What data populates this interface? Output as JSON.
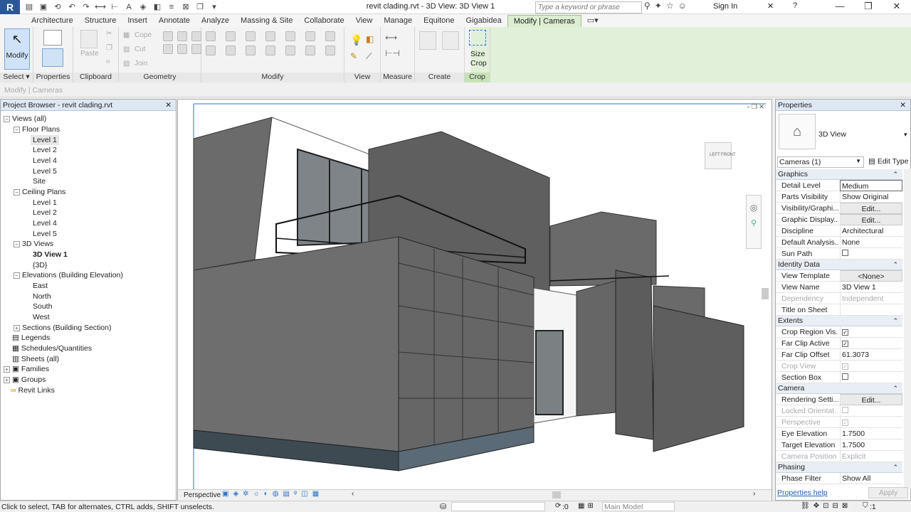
{
  "window": {
    "title": "revit clading.rvt - 3D View: 3D View 1",
    "search_placeholder": "Type a keyword or phrase",
    "sign_in": "Sign In",
    "app_letter": "R"
  },
  "tabs": [
    "Architecture",
    "Structure",
    "Insert",
    "Annotate",
    "Analyze",
    "Massing & Site",
    "Collaborate",
    "View",
    "Manage",
    "Equitone",
    "Gigabidea",
    "Modify | Cameras"
  ],
  "ribbon": {
    "modify": "Modify",
    "select": "Select ▾",
    "properties": "Properties",
    "clipboard": "Clipboard",
    "paste": "Paste",
    "cope": "Cope",
    "cut": "Cut",
    "join": "Join",
    "geometry": "Geometry",
    "modify_panel": "Modify",
    "view": "View",
    "measure": "Measure",
    "create": "Create",
    "size_crop_1": "Size",
    "size_crop_2": "Crop",
    "crop": "Crop"
  },
  "option_bar": "Modify | Cameras",
  "project_browser": {
    "title": "Project Browser - revit clading.rvt",
    "items": [
      "Views (all)",
      "Floor Plans",
      "Level 1",
      "Level 2",
      "Level 4",
      "Level 5",
      "Site",
      "Ceiling Plans",
      "Level 1",
      "Level 2",
      "Level 4",
      "Level 5",
      "3D Views",
      "3D View 1",
      "{3D}",
      "Elevations (Building Elevation)",
      "East",
      "North",
      "South",
      "West",
      "Sections (Building Section)",
      "Legends",
      "Schedules/Quantities",
      "Sheets (all)",
      "Families",
      "Groups",
      "Revit Links"
    ]
  },
  "viewport": {
    "view_mode": "Perspective",
    "cube_left": "LEFT",
    "cube_front": "FRONT"
  },
  "properties": {
    "title": "Properties",
    "type": "3D View",
    "selector": "Cameras (1)",
    "edit_type": "Edit Type",
    "sections": {
      "graphics": "Graphics",
      "identity": "Identity Data",
      "extents": "Extents",
      "camera": "Camera",
      "phasing": "Phasing"
    },
    "rows": {
      "detail_level": [
        "Detail Level",
        "Medium"
      ],
      "parts_visibility": [
        "Parts Visibility",
        "Show Original"
      ],
      "vis_graphics": [
        "Visibility/Graphi...",
        "Edit..."
      ],
      "graphic_display": [
        "Graphic Display...",
        "Edit..."
      ],
      "discipline": [
        "Discipline",
        "Architectural"
      ],
      "default_analysis": [
        "Default Analysis...",
        "None"
      ],
      "sun_path": [
        "Sun Path",
        ""
      ],
      "view_template": [
        "View Template",
        "<None>"
      ],
      "view_name": [
        "View Name",
        "3D View 1"
      ],
      "dependency": [
        "Dependency",
        "Independent"
      ],
      "title_on_sheet": [
        "Title on Sheet",
        ""
      ],
      "crop_region": [
        "Crop Region Vis...",
        ""
      ],
      "far_clip_active": [
        "Far Clip Active",
        ""
      ],
      "far_clip_offset": [
        "Far Clip Offset",
        "61.3073"
      ],
      "crop_view": [
        "Crop View",
        ""
      ],
      "section_box": [
        "Section Box",
        ""
      ],
      "rendering": [
        "Rendering Setti...",
        "Edit..."
      ],
      "locked": [
        "Locked Orientat...",
        ""
      ],
      "perspective": [
        "Perspective",
        ""
      ],
      "eye_elev": [
        "Eye Elevation",
        "1.7500"
      ],
      "target_elev": [
        "Target Elevation",
        "1.7500"
      ],
      "camera_pos": [
        "Camera Position",
        "Explicit"
      ],
      "phase_filter": [
        "Phase Filter",
        "Show All"
      ]
    },
    "help": "Properties help",
    "apply": "Apply"
  },
  "status": {
    "message": "Click to select, TAB for alternates, CTRL adds, SHIFT unselects.",
    "zero": ":0",
    "model": "Main Model",
    "filter_count": ":1"
  }
}
